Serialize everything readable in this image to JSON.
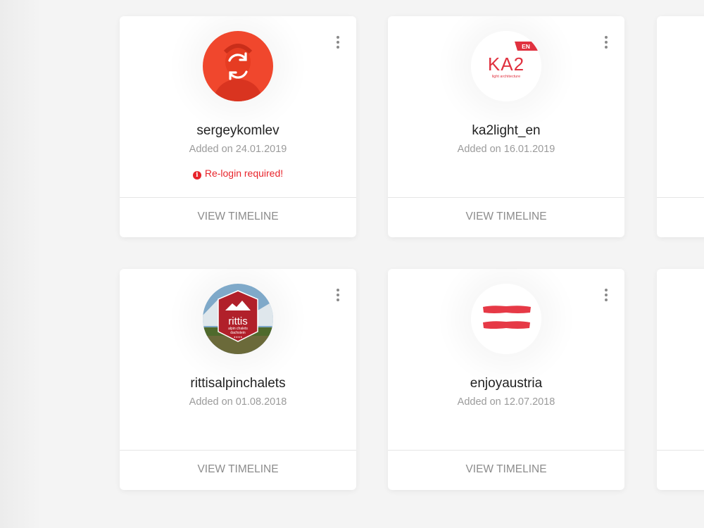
{
  "accounts": [
    {
      "name": "sergeykomlev",
      "added": "Added on 24.01.2019",
      "warning": "Re-login required!",
      "warning_icon": "info-icon",
      "action": "VIEW TIMELINE",
      "avatar_icon": "refresh-icon"
    },
    {
      "name": "ka2light_en",
      "added": "Added on 16.01.2019",
      "action": "VIEW TIMELINE",
      "logo": {
        "main": "KA2",
        "tag": "EN",
        "sub": "light architecture"
      }
    },
    {
      "name": "rittisalpinchalets",
      "added": "Added on 01.08.2018",
      "action": "VIEW TIMELINE",
      "logo": {
        "main": "rittis",
        "line1": "alpin chalets",
        "line2": "dachstein",
        "stars": "★★★★"
      }
    },
    {
      "name": "enjoyaustria",
      "added": "Added on 12.07.2018",
      "action": "VIEW TIMELINE",
      "logo_icon": "austria-flag-icon"
    }
  ],
  "colors": {
    "warning": "#e8242b",
    "avatar_overlay": "#f0472d",
    "ka2_red": "#e0313f",
    "rittis_red": "#b1202a",
    "austria_red": "#e63946"
  }
}
